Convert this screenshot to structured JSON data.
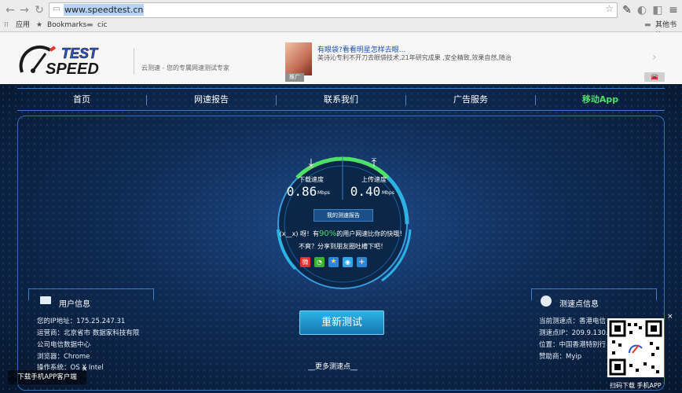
{
  "browser": {
    "url": "www.speedtest.cn",
    "bookmarks": [
      {
        "label": "应用"
      },
      {
        "label": "Bookmarks"
      },
      {
        "label": "cic"
      }
    ],
    "other_bookmarks": "其他书签"
  },
  "header": {
    "logo_top": "TEST",
    "logo_bottom": "SPEED",
    "slogan": "云测速 - 您的专属网速测试专家",
    "ad": {
      "title": "有眼袋?看看明星怎样去眼...",
      "desc": "美诗沁专利不开刀去眼袋技术,21年研究成果 ,安全精致,效果自然,随治",
      "tag": "推广"
    }
  },
  "nav": {
    "items": [
      "首页",
      "网速报告",
      "联系我们",
      "广告服务",
      "移动App"
    ],
    "active_color": "#4fe06a"
  },
  "gauge": {
    "download_label": "下载速度",
    "download_value": "0.86",
    "download_unit": "Mbps",
    "upload_label": "上传速度",
    "upload_value": "0.40",
    "upload_unit": "Mbps",
    "report_button": "我的测速报告",
    "msg1_prefix": "(x__x) 呀！有",
    "msg1_pct": "90%",
    "msg1_suffix": "的用户网速比你的快哦！",
    "msg2": "不爽？分享到朋友圈吐槽下吧！"
  },
  "retest_label": "重新测试",
  "more_nodes": "__更多测速点__",
  "user_info": {
    "title": "用户信息",
    "ip": "您的IP地址：175.25.247.31",
    "isp1": "运营商：北京省市 数据家科技有限",
    "isp2": "公司电信数据中心",
    "browser": "浏览器：Chrome",
    "os": "操作系统：OS X Intel"
  },
  "server_info": {
    "title": "测速点信息",
    "node": "当前测速点：香港电信",
    "ip": "测速点IP：209.9.130.",
    "location": "位置：中国香港特别行",
    "sponsor": "赞助商：Myip"
  },
  "qr_label": "扫码下载 手机APP",
  "app_bar": "下载手机APP客户端",
  "close_x": "×",
  "colors": {
    "accent_blue": "#2db2e4",
    "accent_green": "#4fe06a",
    "highlight_green": "#43d86d"
  }
}
